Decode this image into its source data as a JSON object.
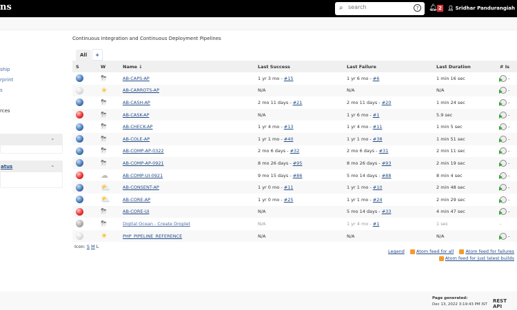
{
  "header": {
    "logo": "ns",
    "search_placeholder": "search",
    "notifications": "2",
    "user": "Sridhar Pandurangiah"
  },
  "sidebar": {
    "links": [
      "ship",
      "rprint",
      "s",
      "rces"
    ],
    "panel2_title": "atus",
    "collapse": "–"
  },
  "description": "Continuous Integration and Continuous Deployment Pipelines",
  "tabs": {
    "all": "All",
    "add": "+"
  },
  "columns": {
    "s": "S",
    "w": "W",
    "name": "Name ↓",
    "last_success": "Last Success",
    "last_failure": "Last Failure",
    "last_duration": "Last Duration",
    "issues": "# Is"
  },
  "jobs": [
    {
      "status": "blue",
      "weather": "storm",
      "name": "AB-CAPS-AP",
      "success": "1 yr 3 mo - ",
      "success_build": "#15",
      "failure": "1 yr 6 mo - ",
      "failure_build": "#6",
      "duration": "1 min 16 sec",
      "issues": "-"
    },
    {
      "status": "notbuilt",
      "weather": "sun",
      "name": "AB-CARROTS-AP",
      "success": "N/A",
      "success_build": "",
      "failure": "N/A",
      "failure_build": "",
      "duration": "N/A",
      "issues": "-"
    },
    {
      "status": "blue",
      "weather": "storm",
      "name": "AB-CASH-AP",
      "success": "2 mo 11 days - ",
      "success_build": "#21",
      "failure": "2 mo 11 days - ",
      "failure_build": "#20",
      "duration": "1 min 24 sec",
      "issues": "-"
    },
    {
      "status": "red",
      "weather": "storm",
      "name": "AB-CASK-AP",
      "success": "N/A",
      "success_build": "",
      "failure": "1 yr 6 mo - ",
      "failure_build": "#1",
      "duration": "5.9 sec",
      "issues": "-"
    },
    {
      "status": "blue",
      "weather": "storm",
      "name": "AB-CHECK-AP",
      "success": "1 yr 4 mo - ",
      "success_build": "#13",
      "failure": "1 yr 4 mo - ",
      "failure_build": "#11",
      "duration": "1 min 5 sec",
      "issues": "-"
    },
    {
      "status": "blue",
      "weather": "storm",
      "name": "AB-COLE-AP",
      "success": "1 yr 1 mo - ",
      "success_build": "#40",
      "failure": "1 yr 1 mo - ",
      "failure_build": "#38",
      "duration": "1 min 51 sec",
      "issues": "-"
    },
    {
      "status": "blue",
      "weather": "storm",
      "name": "AB-COMP-AP-0322",
      "success": "2 mo 6 days - ",
      "success_build": "#32",
      "failure": "2 mo 6 days - ",
      "failure_build": "#31",
      "duration": "2 min 11 sec",
      "issues": "-"
    },
    {
      "status": "blue",
      "weather": "storm",
      "name": "AB-COMP-AP-0921",
      "success": "8 mo 26 days - ",
      "success_build": "#95",
      "failure": "8 mo 26 days - ",
      "failure_build": "#93",
      "duration": "2 min 19 sec",
      "issues": "-"
    },
    {
      "status": "red",
      "weather": "cloud",
      "name": "AB-COMP-UI-0921",
      "success": "9 mo 15 days - ",
      "success_build": "#86",
      "failure": "5 mo 14 days - ",
      "failure_build": "#88",
      "duration": "8 min 4 sec",
      "issues": "-"
    },
    {
      "status": "blue",
      "weather": "partly",
      "name": "AB-CONSENT-AP",
      "success": "1 yr 0 mo - ",
      "success_build": "#11",
      "failure": "1 yr 1 mo - ",
      "failure_build": "#10",
      "duration": "2 min 48 sec",
      "issues": "-"
    },
    {
      "status": "blue",
      "weather": "partly",
      "name": "AB-CORE-AP",
      "success": "1 yr 0 mo - ",
      "success_build": "#25",
      "failure": "1 yr 1 mo - ",
      "failure_build": "#24",
      "duration": "2 min 29 sec",
      "issues": "-"
    },
    {
      "status": "red",
      "weather": "storm",
      "name": "AB-CORE-UI",
      "success": "N/A",
      "success_build": "",
      "failure": "5 mo 14 days - ",
      "failure_build": "#33",
      "duration": "4 min 47 sec",
      "issues": "-"
    },
    {
      "status": "disabled",
      "weather": "storm",
      "name": "Digital Ocean - Create Droplet",
      "success": "N/A",
      "success_build": "",
      "failure": "1 yr 4 mo - ",
      "failure_build": "#1",
      "duration": "1 sec",
      "issues": "-"
    },
    {
      "status": "notbuilt",
      "weather": "sun",
      "name": "PHP_PIPELINE_REFERENCE",
      "success": "N/A",
      "success_build": "",
      "failure": "N/A",
      "failure_build": "",
      "duration": "N/A",
      "issues": "-"
    }
  ],
  "icon_size": {
    "label": "Icon:",
    "s": "S",
    "m": "M",
    "l": "L"
  },
  "feeds": {
    "legend": "Legend",
    "all": "Atom feed for all",
    "failures": "Atom feed for failures",
    "latest": "Atom feed for just latest builds"
  },
  "footer": {
    "generated_label": "Page generated:",
    "generated": "Dec 13, 2022 3:19:43 PM IST",
    "rest_api": "REST API"
  },
  "colors": {
    "topbar": "#000000",
    "link": "#204a87",
    "badge": "#e0343e"
  }
}
